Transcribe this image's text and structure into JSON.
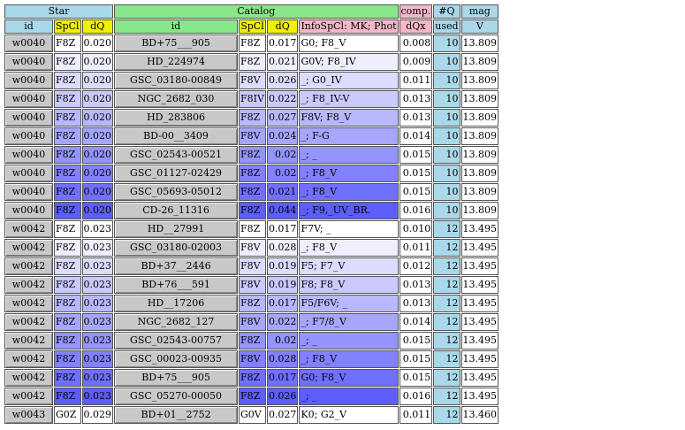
{
  "header": {
    "groups": {
      "star": "Star",
      "catalog": "Catalog",
      "comp": "comp.",
      "nq": "#Q",
      "mag": "mag"
    },
    "columns": {
      "star_id": "id",
      "star_spcl": "SpCl",
      "star_dq": "dQ",
      "cat_id": "id",
      "cat_spcl": "SpCl",
      "cat_dq": "dQ",
      "cat_info": "InfoSpCl:  MK; Phot",
      "comp_dqx": "dQx",
      "used": "used",
      "mag_v": "V"
    }
  },
  "colors": {
    "shade_scale": [
      "#ffffff",
      "#eeeeff",
      "#dcdcff",
      "#cacaff",
      "#b8b8ff",
      "#a6a6ff",
      "#9494ff",
      "#8282ff",
      "#7070ff",
      "#5e5eff"
    ]
  },
  "rows": [
    {
      "sid": "w0040",
      "sspcl": "F8Z",
      "sdq": "0.020",
      "cid": "BD+75___905",
      "cspcl": "F8Z",
      "cdq": "0.017",
      "info": "G0; F8_V",
      "dqx": "0.008",
      "used": "10",
      "mag": "13.809",
      "shade": 0
    },
    {
      "sid": "w0040",
      "sspcl": "F8Z",
      "sdq": "0.020",
      "cid": "HD_224974",
      "cspcl": "F8Z",
      "cdq": "0.021",
      "info": "G0V; F8_IV",
      "dqx": "0.009",
      "used": "10",
      "mag": "13.809",
      "shade": 1
    },
    {
      "sid": "w0040",
      "sspcl": "F8Z",
      "sdq": "0.020",
      "cid": "GSC_03180-00849",
      "cspcl": "F8V",
      "cdq": "0.026",
      "info": "_; G0_IV",
      "dqx": "0.011",
      "used": "10",
      "mag": "13.809",
      "shade": 2
    },
    {
      "sid": "w0040",
      "sspcl": "F8Z",
      "sdq": "0.020",
      "cid": "NGC_2682_030",
      "cspcl": "F8IV",
      "cdq": "0.022",
      "info": "_; F8_IV-V",
      "dqx": "0.013",
      "used": "10",
      "mag": "13.809",
      "shade": 3
    },
    {
      "sid": "w0040",
      "sspcl": "F8Z",
      "sdq": "0.020",
      "cid": "HD_283806",
      "cspcl": "F8Z",
      "cdq": "0.027",
      "info": "F8V; F8_V",
      "dqx": "0.013",
      "used": "10",
      "mag": "13.809",
      "shade": 4
    },
    {
      "sid": "w0040",
      "sspcl": "F8Z",
      "sdq": "0.020",
      "cid": "BD-00__3409",
      "cspcl": "F8V",
      "cdq": "0.024",
      "info": "_; F-G",
      "dqx": "0.014",
      "used": "10",
      "mag": "13.809",
      "shade": 5
    },
    {
      "sid": "w0040",
      "sspcl": "F8Z",
      "sdq": "0.020",
      "cid": "GSC_02543-00521",
      "cspcl": "F8Z",
      "cdq": "0.02",
      "info": "_; _",
      "dqx": "0.015",
      "used": "10",
      "mag": "13.809",
      "shade": 6
    },
    {
      "sid": "w0040",
      "sspcl": "F8Z",
      "sdq": "0.020",
      "cid": "GSC_01127-02429",
      "cspcl": "F8Z",
      "cdq": "0.02",
      "info": "_; F8_V",
      "dqx": "0.015",
      "used": "10",
      "mag": "13.809",
      "shade": 7
    },
    {
      "sid": "w0040",
      "sspcl": "F8Z",
      "sdq": "0.020",
      "cid": "GSC_05693-05012",
      "cspcl": "F8Z",
      "cdq": "0.021",
      "info": "_; F8_V",
      "dqx": "0.015",
      "used": "10",
      "mag": "13.809",
      "shade": 8
    },
    {
      "sid": "w0040",
      "sspcl": "F8Z",
      "sdq": "0.020",
      "cid": "CD-26_11316",
      "cspcl": "F8Z",
      "cdq": "0.044",
      "info": "_; F9,_UV_BR.",
      "dqx": "0.016",
      "used": "10",
      "mag": "13.809",
      "shade": 9
    },
    {
      "sid": "w0042",
      "sspcl": "F8Z",
      "sdq": "0.023",
      "cid": "HD__27991",
      "cspcl": "F8Z",
      "cdq": "0.017",
      "info": "F7V; _",
      "dqx": "0.010",
      "used": "12",
      "mag": "13.495",
      "shade": 0
    },
    {
      "sid": "w0042",
      "sspcl": "F8Z",
      "sdq": "0.023",
      "cid": "GSC_03180-02003",
      "cspcl": "F8V",
      "cdq": "0.028",
      "info": "_; F8_V",
      "dqx": "0.011",
      "used": "12",
      "mag": "13.495",
      "shade": 1
    },
    {
      "sid": "w0042",
      "sspcl": "F8Z",
      "sdq": "0.023",
      "cid": "BD+37__2446",
      "cspcl": "F8V",
      "cdq": "0.019",
      "info": "F5; F7_V",
      "dqx": "0.012",
      "used": "12",
      "mag": "13.495",
      "shade": 2
    },
    {
      "sid": "w0042",
      "sspcl": "F8Z",
      "sdq": "0.023",
      "cid": "BD+76___591",
      "cspcl": "F8V",
      "cdq": "0.019",
      "info": "F8; F8_V",
      "dqx": "0.013",
      "used": "12",
      "mag": "13.495",
      "shade": 3
    },
    {
      "sid": "w0042",
      "sspcl": "F8Z",
      "sdq": "0.023",
      "cid": "HD__17206",
      "cspcl": "F8Z",
      "cdq": "0.017",
      "info": "F5/F6V; _",
      "dqx": "0.013",
      "used": "12",
      "mag": "13.495",
      "shade": 4
    },
    {
      "sid": "w0042",
      "sspcl": "F8Z",
      "sdq": "0.023",
      "cid": "NGC_2682_127",
      "cspcl": "F8V",
      "cdq": "0.022",
      "info": "_; F7/8_V",
      "dqx": "0.014",
      "used": "12",
      "mag": "13.495",
      "shade": 5
    },
    {
      "sid": "w0042",
      "sspcl": "F8Z",
      "sdq": "0.023",
      "cid": "GSC_02543-00757",
      "cspcl": "F8Z",
      "cdq": "0.02",
      "info": "_; _",
      "dqx": "0.015",
      "used": "12",
      "mag": "13.495",
      "shade": 6
    },
    {
      "sid": "w0042",
      "sspcl": "F8Z",
      "sdq": "0.023",
      "cid": "GSC_00023-00935",
      "cspcl": "F8V",
      "cdq": "0.028",
      "info": "_; F8_V",
      "dqx": "0.015",
      "used": "12",
      "mag": "13.495",
      "shade": 7
    },
    {
      "sid": "w0042",
      "sspcl": "F8Z",
      "sdq": "0.023",
      "cid": "BD+75___905",
      "cspcl": "F8Z",
      "cdq": "0.017",
      "info": "G0; F8_V",
      "dqx": "0.015",
      "used": "12",
      "mag": "13.495",
      "shade": 8
    },
    {
      "sid": "w0042",
      "sspcl": "F8Z",
      "sdq": "0.023",
      "cid": "GSC_05270-00050",
      "cspcl": "F8Z",
      "cdq": "0.026",
      "info": "_; _",
      "dqx": "0.016",
      "used": "12",
      "mag": "13.495",
      "shade": 9
    },
    {
      "sid": "w0043",
      "sspcl": "G0Z",
      "sdq": "0.029",
      "cid": "BD+01__2752",
      "cspcl": "G0V",
      "cdq": "0.027",
      "info": "K0; G2_V",
      "dqx": "0.011",
      "used": "12",
      "mag": "13.460",
      "shade": 0
    }
  ]
}
